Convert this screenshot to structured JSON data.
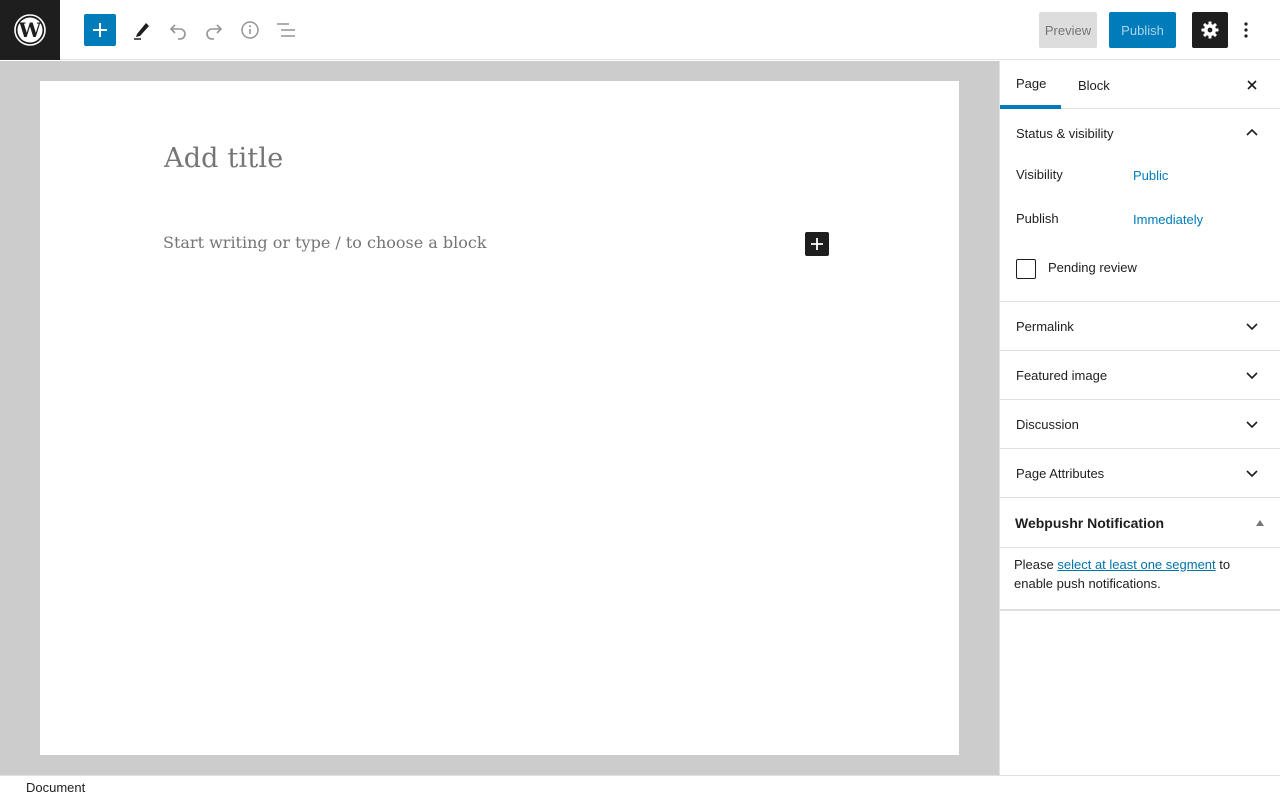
{
  "toolbar": {
    "logo_icon": "wordpress-logo-icon",
    "inserter_icon": "plus-icon",
    "tools_icon": "pencil-icon",
    "undo_icon": "undo-icon",
    "redo_icon": "redo-icon",
    "details_icon": "info-icon",
    "outline_icon": "list-view-icon",
    "preview_label": "Preview",
    "publish_label": "Publish",
    "settings_icon": "gear-icon",
    "more_icon": "more-vertical-icon",
    "accent_color": "#007cba"
  },
  "editor": {
    "title_placeholder": "Add title",
    "paragraph_placeholder": "Start writing or type / to choose a block",
    "block_inserter_icon": "plus-icon"
  },
  "sidebar": {
    "tabs": [
      {
        "label": "Page",
        "active": true
      },
      {
        "label": "Block",
        "active": false
      }
    ],
    "close_icon": "close-icon",
    "status_panel": {
      "title": "Status & visibility",
      "expanded": true,
      "visibility_label": "Visibility",
      "visibility_value": "Public",
      "publish_label": "Publish",
      "publish_value": "Immediately",
      "pending_label": "Pending review",
      "pending_checked": false
    },
    "panels": [
      {
        "title": "Permalink"
      },
      {
        "title": "Featured image"
      },
      {
        "title": "Discussion"
      },
      {
        "title": "Page Attributes"
      }
    ],
    "webpushr": {
      "title": "Webpushr Notification",
      "text_before": "Please ",
      "link_text": "select at least one segment",
      "text_after": " to enable push notifications."
    }
  },
  "footer": {
    "breadcrumb": "Document"
  }
}
